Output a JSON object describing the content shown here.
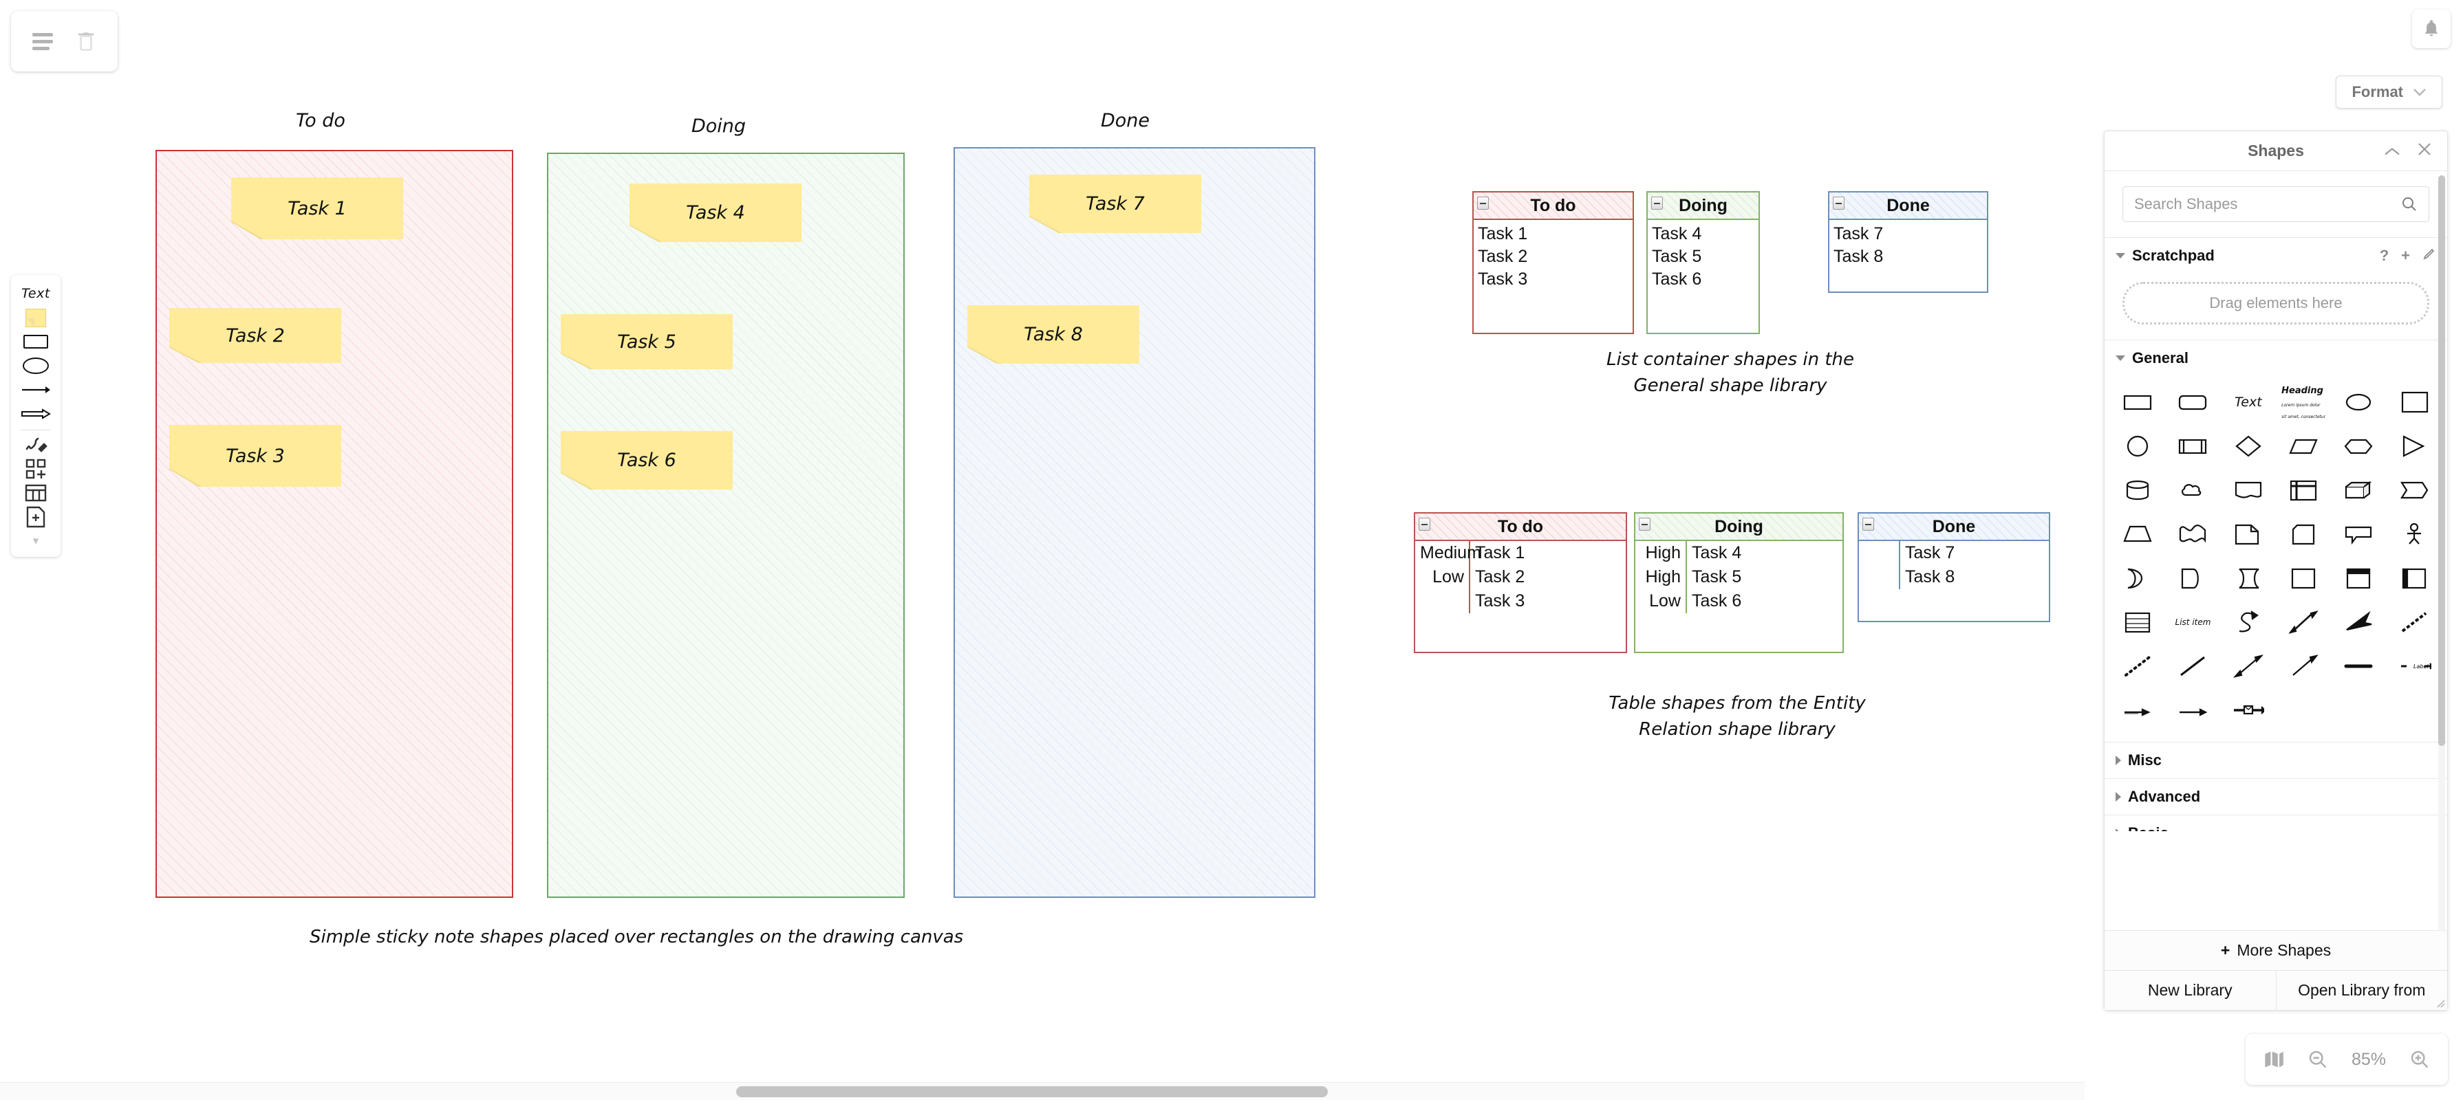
{
  "toolbar": {
    "menu_icon": "hamburger-menu-icon",
    "delete_icon": "trash-icon"
  },
  "left_toolbar": {
    "text_label": "Text",
    "items": [
      {
        "name": "text-tool",
        "label": "Text"
      },
      {
        "name": "sticky-note-tool",
        "label": "Sticky Note"
      },
      {
        "name": "rectangle-tool",
        "label": "Rectangle"
      },
      {
        "name": "ellipse-tool",
        "label": "Ellipse"
      },
      {
        "name": "arrow-tool",
        "label": "Arrow"
      },
      {
        "name": "thick-arrow-tool",
        "label": "Thick Arrow"
      },
      {
        "name": "freehand-tool",
        "label": "Freehand"
      },
      {
        "name": "add-shapes-tool",
        "label": "Add Shapes"
      },
      {
        "name": "table-tool",
        "label": "Table"
      },
      {
        "name": "add-page-tool",
        "label": "Add Page"
      },
      {
        "name": "more-tools-chevron",
        "label": "More"
      }
    ]
  },
  "canvas": {
    "caption": "Simple sticky note shapes placed over rectangles on the drawing canvas",
    "columns": [
      {
        "title": "To do",
        "color": "#cc3333",
        "fill": "#fdf2f2",
        "notes": [
          "Task 1",
          "Task 2",
          "Task 3"
        ]
      },
      {
        "title": "Doing",
        "color": "#69a869",
        "fill": "#f4faf4",
        "notes": [
          "Task 4",
          "Task 5",
          "Task 6"
        ]
      },
      {
        "title": "Done",
        "color": "#6c8ebf",
        "fill": "#f3f7fc",
        "notes": [
          "Task 7",
          "Task 8"
        ]
      }
    ],
    "sticky_color": "#ffeb99"
  },
  "list_containers": {
    "caption": "List container shapes in the\nGeneral shape library",
    "items": [
      {
        "title": "To do",
        "color": "#b85450",
        "header_fill": "#fdf0f0",
        "tasks": [
          "Task 1",
          "Task 2",
          "Task 3"
        ]
      },
      {
        "title": "Doing",
        "color": "#82b366",
        "header_fill": "#f2f9f0",
        "tasks": [
          "Task 4",
          "Task 5",
          "Task 6"
        ]
      },
      {
        "title": "Done",
        "color": "#6c8ebf",
        "header_fill": "#f1f6fc",
        "tasks": [
          "Task 7",
          "Task 8"
        ]
      }
    ]
  },
  "er_tables": {
    "caption": "Table shapes from the Entity\nRelation shape library",
    "items": [
      {
        "title": "To do",
        "color": "#b85450",
        "header_fill": "#fdf0f0",
        "priorities": [
          "Medium",
          "Low",
          ""
        ],
        "tasks": [
          "Task 1",
          "Task 2",
          "Task 3"
        ]
      },
      {
        "title": "Doing",
        "color": "#82b366",
        "header_fill": "#f2f9f0",
        "priorities": [
          "High",
          "High",
          "Low"
        ],
        "tasks": [
          "Task 4",
          "Task 5",
          "Task 6"
        ]
      },
      {
        "title": "Done",
        "color": "#6c8ebf",
        "header_fill": "#f1f6fc",
        "priorities": [
          "",
          ""
        ],
        "tasks": [
          "Task 7",
          "Task 8"
        ]
      }
    ]
  },
  "topbar": {
    "bell_icon": "notification-bell-icon",
    "format_label": "Format",
    "format_chevron": "chevron-down-icon"
  },
  "shapes_panel": {
    "title": "Shapes",
    "collapse_icon": "chevron-up-icon",
    "close_icon": "close-icon",
    "search_placeholder": "Search Shapes",
    "search_value": "",
    "search_icon": "search-icon",
    "sections": [
      {
        "label": "Scratchpad",
        "expanded": true,
        "actions": [
          "help-icon",
          "add-icon",
          "edit-pencil-icon"
        ]
      },
      {
        "label": "General",
        "expanded": true
      },
      {
        "label": "Misc",
        "expanded": false
      },
      {
        "label": "Advanced",
        "expanded": false
      },
      {
        "label": "Basic",
        "expanded": false
      }
    ],
    "scratchpad_placeholder": "Drag elements here",
    "more_shapes_label": "More Shapes",
    "more_shapes_icon": "plus-icon",
    "new_library_label": "New Library",
    "open_library_label": "Open Library from",
    "general_shapes": [
      "rectangle",
      "rounded-rectangle",
      "text",
      "heading-text",
      "ellipse",
      "square",
      "circle",
      "process",
      "diamond",
      "parallelogram",
      "hexagon",
      "triangle",
      "cylinder",
      "cloud",
      "document",
      "internal-storage",
      "cube",
      "step",
      "trapezoid",
      "tape",
      "note",
      "card",
      "callout",
      "actor",
      "or",
      "delay",
      "data-storage",
      "square-plain",
      "vertical-container",
      "horizontal-container",
      "list",
      "list-item",
      "curved-arrow",
      "double-arrow",
      "filled-arrow",
      "dashed-diagonal",
      "dotted-line",
      "plain-line",
      "bidirectional-arrow",
      "single-arrow",
      "thick-line",
      "labelled-arrow",
      "source-label-arrow",
      "source-target-arrow",
      "envelope-connector"
    ]
  },
  "zoom_bar": {
    "outline_icon": "map-outline-icon",
    "zoom_out_icon": "zoom-out-icon",
    "zoom_level": "85%",
    "zoom_in_icon": "zoom-in-icon"
  }
}
